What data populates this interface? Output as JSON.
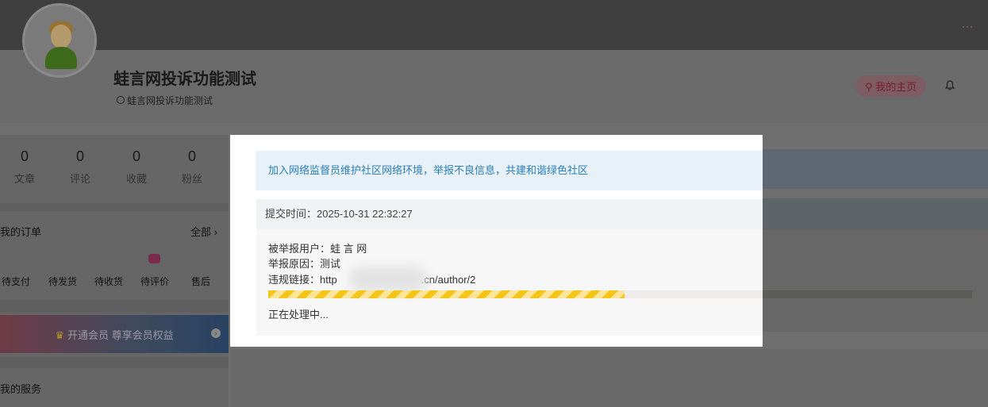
{
  "topbar": {
    "menu_dots": "···"
  },
  "profile": {
    "name": "蛙言网投诉功能测试",
    "subtitle": "蛙言网投诉功能测试",
    "home_button": "我的主页"
  },
  "stats": [
    {
      "value": "0",
      "label": "文章"
    },
    {
      "value": "0",
      "label": "评论"
    },
    {
      "value": "0",
      "label": "收藏"
    },
    {
      "value": "0",
      "label": "粉丝"
    }
  ],
  "orders": {
    "title": "我的订单",
    "all_label": "全部 ›",
    "items": [
      "待支付",
      "待发货",
      "待收货",
      "待评价",
      "售后"
    ]
  },
  "vip": {
    "label": "开通会员 尊享会员权益",
    "crown_icon": "♛"
  },
  "services": {
    "title": "我的服务"
  },
  "modal": {
    "notice": "加入网络监督员维护社区网络环境，举报不良信息，共建和谐绿色社区",
    "submit_time": "提交时间：2025-10-31 22:32:27",
    "reported_user": "被举报用户：蛙 言 网",
    "reason": "举报原因：测试",
    "link_prefix": "违规链接：http",
    "link_suffix": ".cn/author/2",
    "progress": 0.72,
    "status": "正在处理中..."
  }
}
